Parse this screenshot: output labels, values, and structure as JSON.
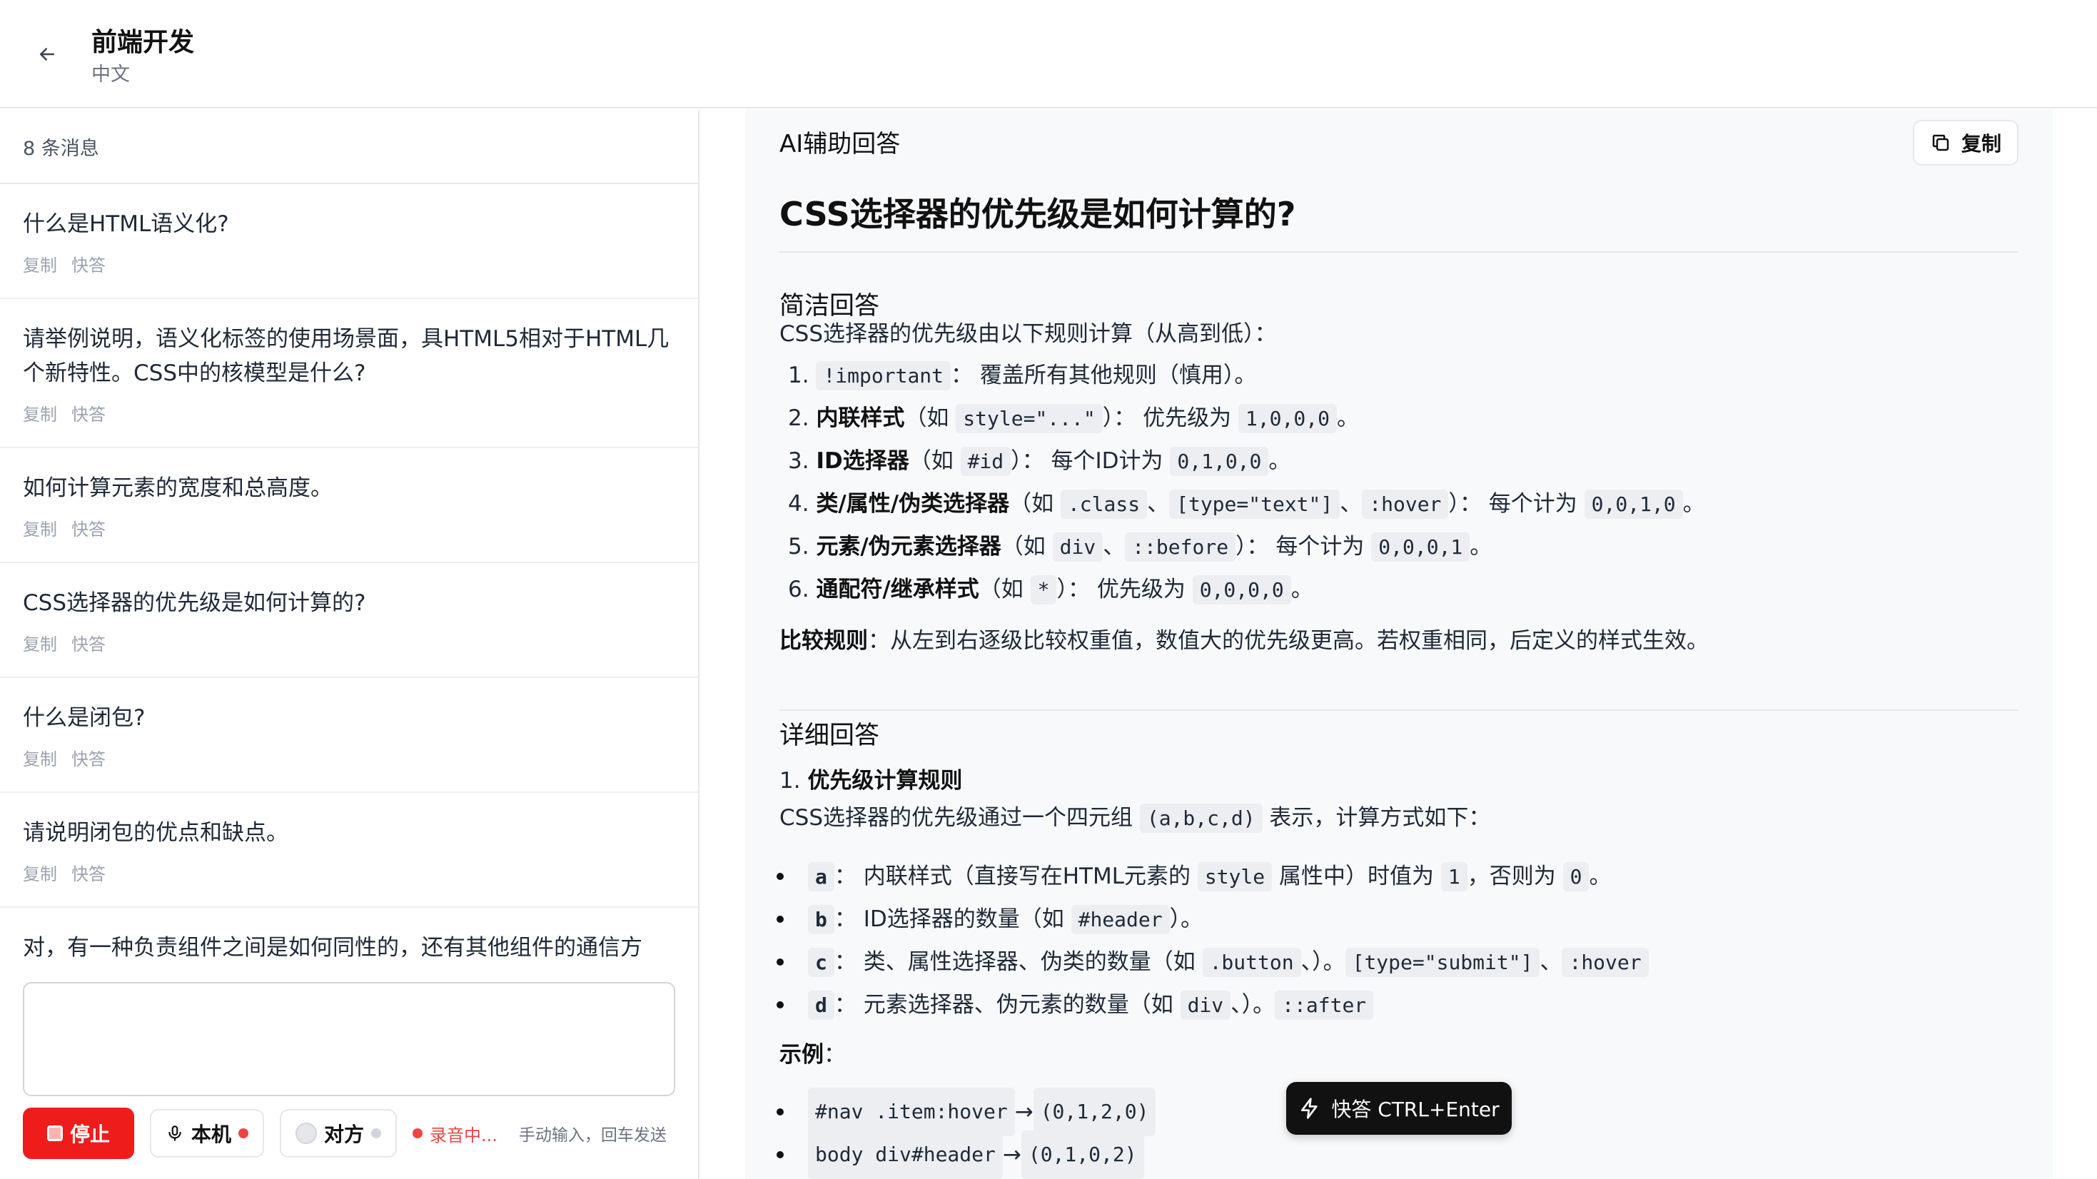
{
  "header": {
    "title": "前端开发",
    "subtitle": "中文"
  },
  "left": {
    "message_count": "8 条消息",
    "messages": [
      {
        "text": "什么是HTML语义化?"
      },
      {
        "text": "请举例说明，语义化标签的使用场景面，具HTML5相对于HTML几个新特性。CSS中的核模型是什么?"
      },
      {
        "text": "如何计算元素的宽度和总高度。"
      },
      {
        "text": "CSS选择器的优先级是如何计算的?"
      },
      {
        "text": "什么是闭包?"
      },
      {
        "text": "请说明闭包的优点和缺点。"
      },
      {
        "text": "对，有一种负责组件之间是如何同性的，还有其他组件的通信方"
      }
    ],
    "action_copy": "复制",
    "action_quick": "快答",
    "input_placeholder": "",
    "controls": {
      "stop_label": "停止",
      "local_label": "本机",
      "remote_label": "对方",
      "recording_label": "录音中...",
      "hint": "手动输入，回车发送"
    }
  },
  "right": {
    "ai_label": "AI辅助回答",
    "copy_label": "复制",
    "question_title": "CSS选择器的优先级是如何计算的?",
    "brief": {
      "title": "简洁回答",
      "intro": "CSS选择器的优先级由以下规则计算（从高到低）：",
      "rules": [
        {
          "num": "1.",
          "code1": "!important",
          "text": "：  覆盖所有其他规则（慎用）。"
        },
        {
          "num": "2.",
          "bold": "内联样式",
          "pre": "（如 ",
          "code1": "style=\"...\"",
          "mid": "）：  优先级为 ",
          "code2": "1,0,0,0",
          "post": "。"
        },
        {
          "num": "3.",
          "bold": "ID选择器",
          "pre": "（如 ",
          "code1": "#id",
          "mid": "）：  每个ID计为 ",
          "code2": "0,1,0,0",
          "post": "。"
        },
        {
          "num": "4.",
          "bold": "类/属性/伪类选择器",
          "pre": "（如 ",
          "code1": ".class",
          "sep1": "、",
          "code1b": "[type=\"text\"]",
          "sep2": "、",
          "code1c": ":hover",
          "mid": "）：  每个计为 ",
          "code2": "0,0,1,0",
          "post": "。"
        },
        {
          "num": "5.",
          "bold": "元素/伪元素选择器",
          "pre": "（如 ",
          "code1": "div",
          "sep1": "、",
          "code1b": "::before",
          "mid": "）：  每个计为 ",
          "code2": "0,0,0,1",
          "post": "。"
        },
        {
          "num": "6.",
          "bold": "通配符/继承样式",
          "pre": "（如 ",
          "code1": "*",
          "mid": "）：  优先级为 ",
          "code2": "0,0,0,0",
          "post": "。"
        }
      ],
      "compare_bold": "比较规则",
      "compare_text": "：从左到右逐级比较权重值，数值大的优先级更高。若权重相同，后定义的样式生效。"
    },
    "detail": {
      "title": "详细回答",
      "sub_num": "1.",
      "sub_title": "优先级计算规则",
      "intro_pre": "CSS选择器的优先级通过一个四元组 ",
      "intro_code": "(a,b,c,d)",
      "intro_post": " 表示，计算方式如下：",
      "bullets": [
        {
          "code": "a",
          "t1": "：  内联样式（直接写在HTML元素的 ",
          "c2": "style",
          "t2": " 属性中）时值为 ",
          "c3": "1",
          "t3": "，否则为 ",
          "c4": "0",
          "t4": "。"
        },
        {
          "code": "b",
          "t1": "：  ID选择器的数量（如 ",
          "c2": "#header",
          "t2": "）。"
        },
        {
          "code": "c",
          "t1": "：  类、属性选择器、伪类的数量（如 ",
          "c2": ".button",
          "s1": "、",
          "c3": "[type=\"submit\"]",
          "s2": "、",
          "c4": ":hover",
          "t2": "）。"
        },
        {
          "code": "d",
          "t1": "：  元素选择器、伪元素的数量（如 ",
          "c2": "div",
          "s1": "、",
          "c3": "::after",
          "t2": "）。"
        }
      ],
      "example_label": "示例",
      "example_colon": "：",
      "examples": [
        {
          "sel": "#nav .item:hover",
          "arrow": "→",
          "val": "(0,1,2,0)"
        },
        {
          "sel": "body div#header",
          "arrow": "→",
          "val": "(0,1,0,2)"
        }
      ]
    },
    "quick_button": "快答 CTRL+Enter"
  }
}
